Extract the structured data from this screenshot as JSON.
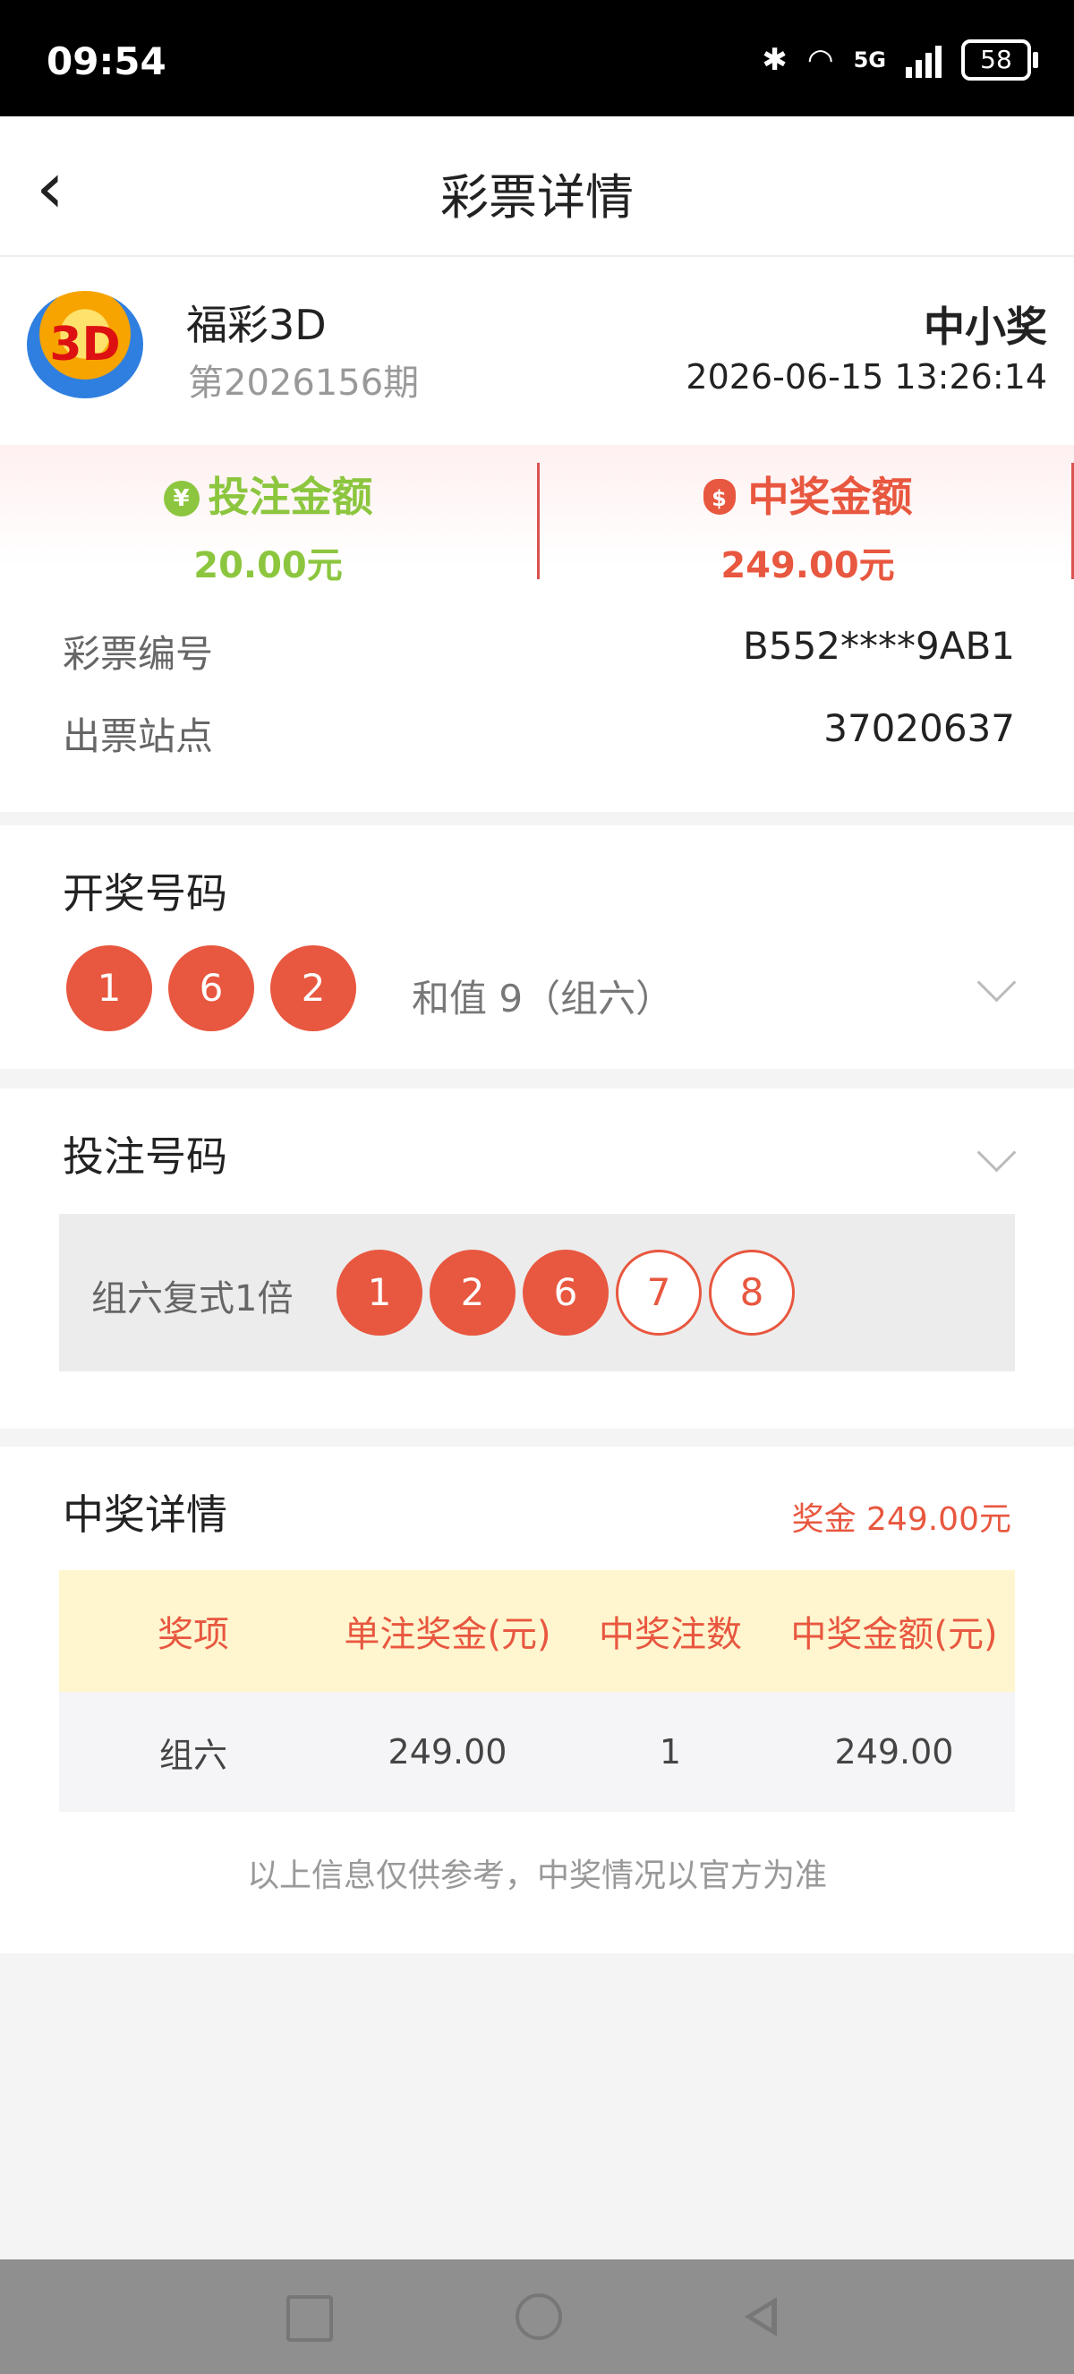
{
  "status_bar": {
    "time": "09:54",
    "network": "5G",
    "battery": "58"
  },
  "header": {
    "title": "彩票详情"
  },
  "lottery": {
    "logo_text": "3D",
    "name": "福彩3D",
    "issue": "第2026156期",
    "prize_status": "中小奖",
    "draw_time": "2026-06-15 13:26:14"
  },
  "amounts": {
    "bet_label": "投注金额",
    "bet_value": "20.00元",
    "bet_icon": "yuan-coin-icon",
    "win_label": "中奖金额",
    "win_value": "249.00元",
    "win_icon": "money-bag-icon"
  },
  "details": [
    {
      "label": "彩票编号",
      "value": "B552****9AB1"
    },
    {
      "label": "出票站点",
      "value": "37020637"
    }
  ],
  "draw": {
    "title": "开奖号码",
    "numbers": [
      "1",
      "6",
      "2"
    ],
    "sum_text": "和值  9（组六）"
  },
  "bet": {
    "title": "投注号码",
    "type": "组六复式1倍",
    "numbers": [
      {
        "value": "1",
        "hit": true
      },
      {
        "value": "2",
        "hit": true
      },
      {
        "value": "6",
        "hit": true
      },
      {
        "value": "7",
        "hit": false
      },
      {
        "value": "8",
        "hit": false
      }
    ]
  },
  "prize": {
    "title": "中奖详情",
    "total": "奖金 249.00元",
    "columns": [
      "奖项",
      "单注奖金(元)",
      "中奖注数",
      "中奖金额(元)"
    ],
    "rows": [
      [
        "组六",
        "249.00",
        "1",
        "249.00"
      ]
    ],
    "disclaimer": "以上信息仅供参考，中奖情况以官方为准"
  },
  "colors": {
    "accent": "#e8573f",
    "green": "#8cc63f",
    "table_header_bg": "#fff5cf"
  }
}
